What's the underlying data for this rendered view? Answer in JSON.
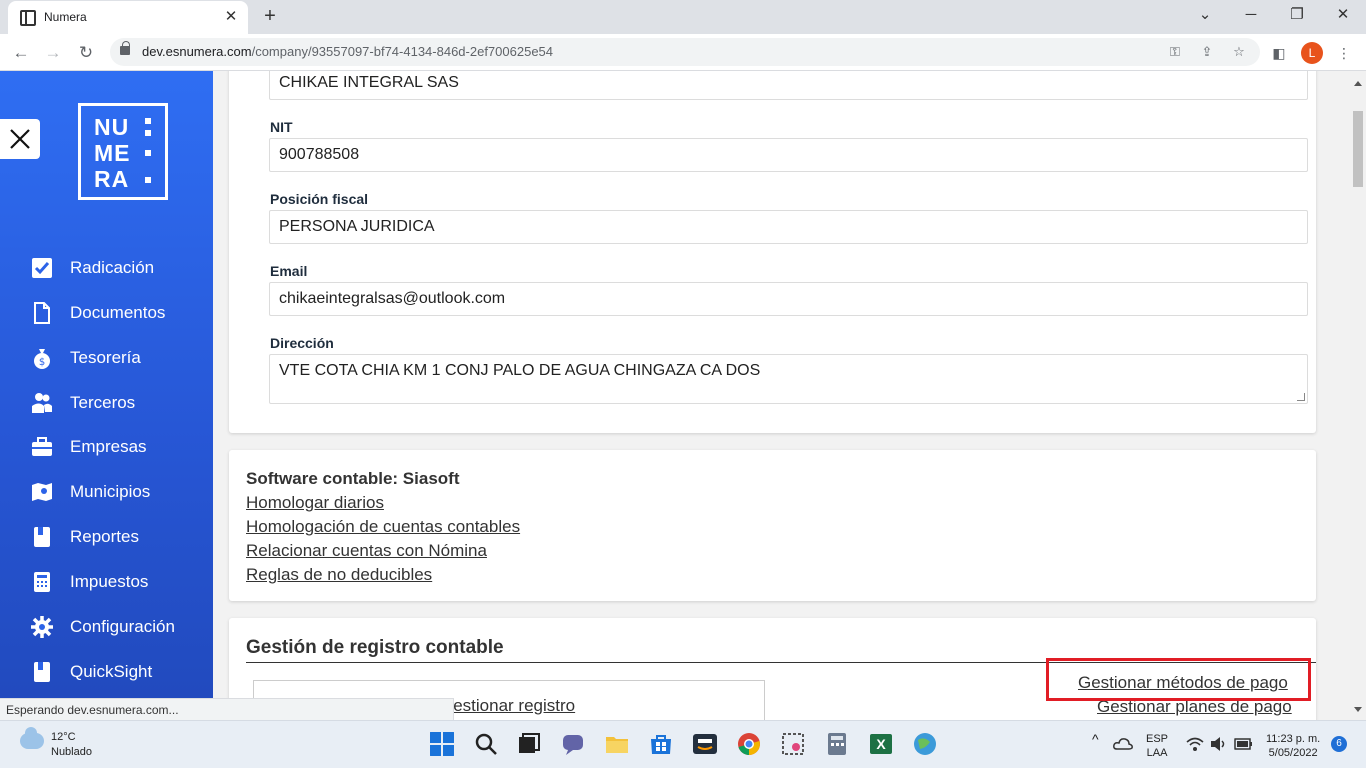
{
  "browser": {
    "tab_title": "Numera",
    "tab_close": "✕",
    "new_tab": "+",
    "url_host": "dev.esnumera.com",
    "url_path": "/company/93557097-bf74-4134-846d-2ef700625e54",
    "status_text": "Esperando dev.esnumera.com...",
    "profile_initial": "L"
  },
  "sidebar": {
    "logo": [
      "NU",
      "ME",
      "RA"
    ],
    "items": [
      {
        "label": "Radicación",
        "icon": "check-square-icon"
      },
      {
        "label": "Documentos",
        "icon": "document-icon"
      },
      {
        "label": "Tesorería",
        "icon": "money-bag-icon"
      },
      {
        "label": "Terceros",
        "icon": "users-icon"
      },
      {
        "label": "Empresas",
        "icon": "briefcase-icon"
      },
      {
        "label": "Municipios",
        "icon": "map-icon"
      },
      {
        "label": "Reportes",
        "icon": "book-icon"
      },
      {
        "label": "Impuestos",
        "icon": "calculator-icon"
      },
      {
        "label": "Configuración",
        "icon": "gear-icon"
      },
      {
        "label": "QuickSight",
        "icon": "book-icon"
      }
    ]
  },
  "company": {
    "name_value": "CHIKAE INTEGRAL SAS",
    "nit_label": "NIT",
    "nit_value": "900788508",
    "fiscal_label": "Posición fiscal",
    "fiscal_value": "PERSONA JURIDICA",
    "email_label": "Email",
    "email_value": "chikaeintegralsas@outlook.com",
    "address_label": "Dirección",
    "address_value": "VTE COTA CHIA KM 1 CONJ PALO DE AGUA CHINGAZA CA DOS"
  },
  "software": {
    "title": "Software contable: Siasoft",
    "links": [
      "Homologar diarios",
      "Homologación de cuentas contables",
      "Relacionar cuentas con Nómina",
      "Reglas de no deducibles"
    ]
  },
  "registro": {
    "title": "Gestión de registro contable",
    "manage_registro": "Gestionar registro",
    "manage_payment_methods": "Gestionar métodos de pago",
    "manage_payment_plans": "Gestionar planes de pago"
  },
  "taskbar": {
    "temperature": "12°C",
    "weather": "Nublado",
    "language_top": "ESP",
    "language_bottom": "LAA",
    "time": "11:23 p. m.",
    "date": "5/05/2022",
    "notifications": "6"
  },
  "colors": {
    "sidebar_top": "#2f6ef3",
    "sidebar_bottom": "#2149bc",
    "highlight": "#e11d25"
  }
}
